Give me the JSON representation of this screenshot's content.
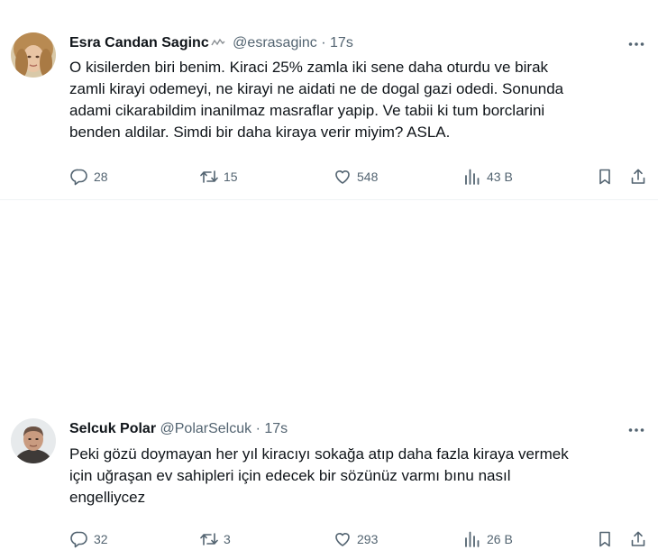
{
  "tweets": [
    {
      "name": "Esra Candan Saginc",
      "handle": "@esrasaginc",
      "separator": "·",
      "time": "17s",
      "text_lines": [
        "O kisilerden biri benim. Kiraci 25% zamla iki sene daha oturdu ve birak",
        "zamli kirayi odemeyi, ne kirayi ne aidati ne de dogal gazi odedi. Sonunda",
        "adami cikarabildim inanilmaz masraflar yapip. Ve tabii ki tum borclarini",
        "benden aldilar. Simdi bir daha kiraya verir miyim? ASLA."
      ],
      "replies": "28",
      "retweets": "15",
      "likes": "548",
      "views": "43 B"
    },
    {
      "name": "Selcuk Polar",
      "handle": "@PolarSelcuk",
      "separator": "·",
      "time": "17s",
      "text_lines": [
        "Peki gözü doymayan her yıl kiracıyı sokağa atıp daha fazla kiraya vermek",
        "için uğraşan ev sahipleri için edecek bir sözünüz varmı bınu nasıl",
        "engelliycez"
      ],
      "replies": "32",
      "retweets": "3",
      "likes": "293",
      "views": "26 B"
    }
  ],
  "icons": {
    "reply": "reply-icon",
    "retweet": "retweet-icon",
    "like": "heart-icon",
    "views": "views-icon",
    "bookmark": "bookmark-icon",
    "share": "share-icon",
    "more": "more-icon"
  },
  "colors": {
    "text": "#0f1419",
    "secondary": "#536471",
    "divider": "#eff3f4"
  }
}
